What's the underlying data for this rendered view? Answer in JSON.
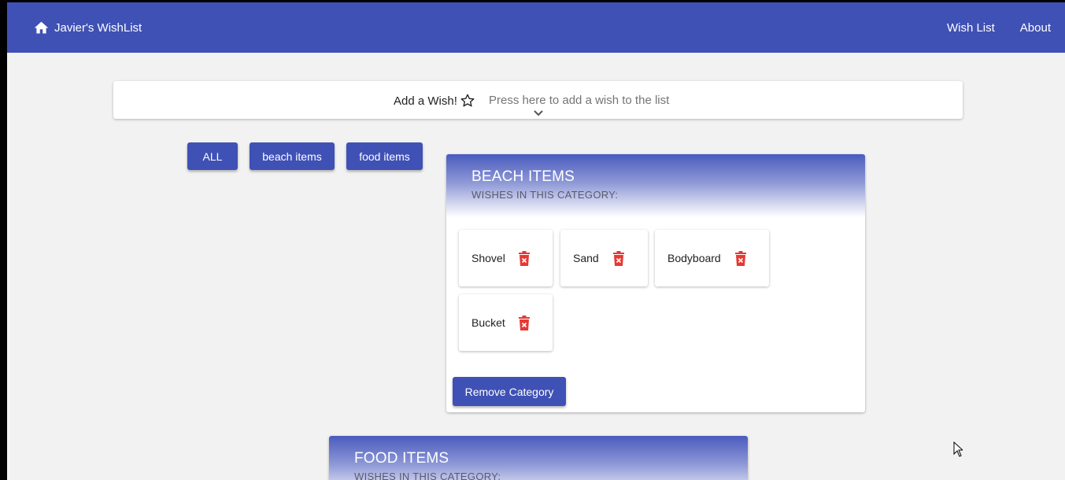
{
  "navbar": {
    "brand_label": "Javier's WishList",
    "links": [
      "Wish List",
      "About"
    ],
    "color": "#3f51b5"
  },
  "add_wish": {
    "title": "Add a Wish!",
    "hint": "Press here to add a wish to the list"
  },
  "filters": [
    "ALL",
    "beach items",
    "food items"
  ],
  "categories": [
    {
      "title": "BEACH ITEMS",
      "subtitle": "WISHES IN THIS CATEGORY:",
      "wishes": [
        "Shovel",
        "Sand",
        "Bodyboard",
        "Bucket"
      ],
      "remove_label": "Remove Category"
    },
    {
      "title": "FOOD ITEMS",
      "subtitle": "WISHES IN THIS CATEGORY:"
    }
  ],
  "icons": {
    "home": "home-icon",
    "star": "star-outline-icon",
    "chevron": "chevron-down-icon",
    "delete": "trash-icon"
  },
  "colors": {
    "primary": "#3f51b5",
    "delete": "#e53935",
    "background": "#f2f2f2"
  }
}
